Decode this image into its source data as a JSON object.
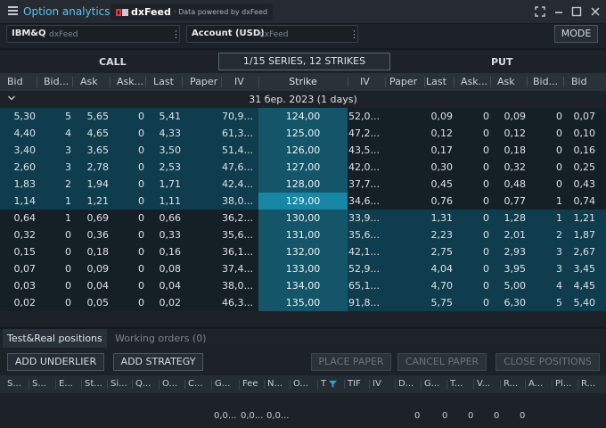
{
  "app": {
    "title": "Option analytics",
    "brand_name": "dxFeed",
    "brand_sub": "· Data powered by dxFeed"
  },
  "icons": {
    "menu": "hamburger-icon",
    "expand": "expand-icon",
    "minimize": "minimize-icon",
    "maximize": "maximize-icon",
    "close": "close-icon"
  },
  "symbol_select": {
    "value": "IBM&Q",
    "source": "dxFeed"
  },
  "account_select": {
    "value": "Account (USD)",
    "source": "dxFeed"
  },
  "mode_label": "MODE",
  "call_label": "CALL",
  "put_label": "PUT",
  "series_label": "1/15 SERIES, 12 STRIKES",
  "columns": [
    "Bid",
    "Bid...",
    "Ask",
    "Ask...",
    "Last",
    "Paper",
    "IV",
    "Strike",
    "IV",
    "Paper",
    "Last",
    "Ask...",
    "Ask",
    "Bid...",
    "Bid"
  ],
  "expiry_label": "31 бер. 2023 (1 days)",
  "colors": {
    "itm_bg": "#0f3d4e",
    "otm_bg": "#152026",
    "strike_bg": "#14556a",
    "atm_strike_bg": "#1787a5",
    "accent": "#5fc3ee"
  },
  "rows": [
    {
      "call": [
        "5,30",
        "5",
        "5,65",
        "0",
        "5,41",
        "",
        "70,9..."
      ],
      "strike": "124,00",
      "put": [
        "52,0...",
        "",
        "0,09",
        "0",
        "0,09",
        "0",
        "0,07"
      ]
    },
    {
      "call": [
        "4,40",
        "4",
        "4,65",
        "0",
        "4,33",
        "",
        "61,3..."
      ],
      "strike": "125,00",
      "put": [
        "47,2...",
        "",
        "0,12",
        "0",
        "0,12",
        "0",
        "0,10"
      ]
    },
    {
      "call": [
        "3,40",
        "3",
        "3,65",
        "0",
        "3,50",
        "",
        "51,4..."
      ],
      "strike": "126,00",
      "put": [
        "43,5...",
        "",
        "0,17",
        "0",
        "0,18",
        "0",
        "0,16"
      ]
    },
    {
      "call": [
        "2,60",
        "3",
        "2,78",
        "0",
        "2,53",
        "",
        "47,6..."
      ],
      "strike": "127,00",
      "put": [
        "42,0...",
        "",
        "0,30",
        "0",
        "0,32",
        "0",
        "0,25"
      ]
    },
    {
      "call": [
        "1,83",
        "2",
        "1,94",
        "0",
        "1,71",
        "",
        "42,4..."
      ],
      "strike": "128,00",
      "put": [
        "37,7...",
        "",
        "0,45",
        "0",
        "0,48",
        "0",
        "0,43"
      ]
    },
    {
      "call": [
        "1,14",
        "1",
        "1,21",
        "0",
        "1,11",
        "",
        "38,0..."
      ],
      "strike": "129,00",
      "put": [
        "34,6...",
        "",
        "0,76",
        "0",
        "0,77",
        "1",
        "0,74"
      ]
    },
    {
      "call": [
        "0,64",
        "1",
        "0,69",
        "0",
        "0,66",
        "",
        "36,2..."
      ],
      "strike": "130,00",
      "put": [
        "33,9...",
        "",
        "1,31",
        "0",
        "1,28",
        "1",
        "1,21"
      ]
    },
    {
      "call": [
        "0,32",
        "0",
        "0,36",
        "0",
        "0,33",
        "",
        "35,6..."
      ],
      "strike": "131,00",
      "put": [
        "35,6...",
        "",
        "2,23",
        "0",
        "2,01",
        "2",
        "1,87"
      ]
    },
    {
      "call": [
        "0,15",
        "0",
        "0,18",
        "0",
        "0,16",
        "",
        "36,1..."
      ],
      "strike": "132,00",
      "put": [
        "42,1...",
        "",
        "2,75",
        "0",
        "2,93",
        "3",
        "2,67"
      ]
    },
    {
      "call": [
        "0,07",
        "0",
        "0,09",
        "0",
        "0,08",
        "",
        "37,4..."
      ],
      "strike": "133,00",
      "put": [
        "52,9...",
        "",
        "4,04",
        "0",
        "3,95",
        "3",
        "3,45"
      ]
    },
    {
      "call": [
        "0,03",
        "0",
        "0,04",
        "0",
        "0,04",
        "",
        "38,0..."
      ],
      "strike": "134,00",
      "put": [
        "65,1...",
        "",
        "4,70",
        "0",
        "5,00",
        "4",
        "4,45"
      ]
    },
    {
      "call": [
        "0,02",
        "0",
        "0,05",
        "0",
        "0,02",
        "",
        "46,3..."
      ],
      "strike": "135,00",
      "put": [
        "91,8...",
        "",
        "5,75",
        "0",
        "6,30",
        "5",
        "5,40"
      ]
    }
  ],
  "tabs": [
    {
      "label": "Test&Real positions"
    },
    {
      "label": "Working orders (0)"
    }
  ],
  "buttons": {
    "add_underlier": "ADD UNDERLIER",
    "add_strategy": "ADD STRATEGY",
    "place_paper": "PLACE PAPER",
    "cancel_paper": "CANCEL PAPER",
    "close_positions": "CLOSE POSITIONS"
  },
  "positions_columns": [
    "S...",
    "S...",
    "E...",
    "St...",
    "Si...",
    "Q...",
    "O...",
    "C...",
    "G...",
    "Fee",
    "N...",
    "O...",
    "T",
    "TIF",
    "IV",
    "D...",
    "G...",
    "T...",
    "V...",
    "R...",
    "A...",
    "Pl...",
    "R..."
  ],
  "totals": [
    "0,0...",
    "0,0...",
    "0,0...",
    "0",
    "0",
    "0",
    "0",
    "0"
  ]
}
